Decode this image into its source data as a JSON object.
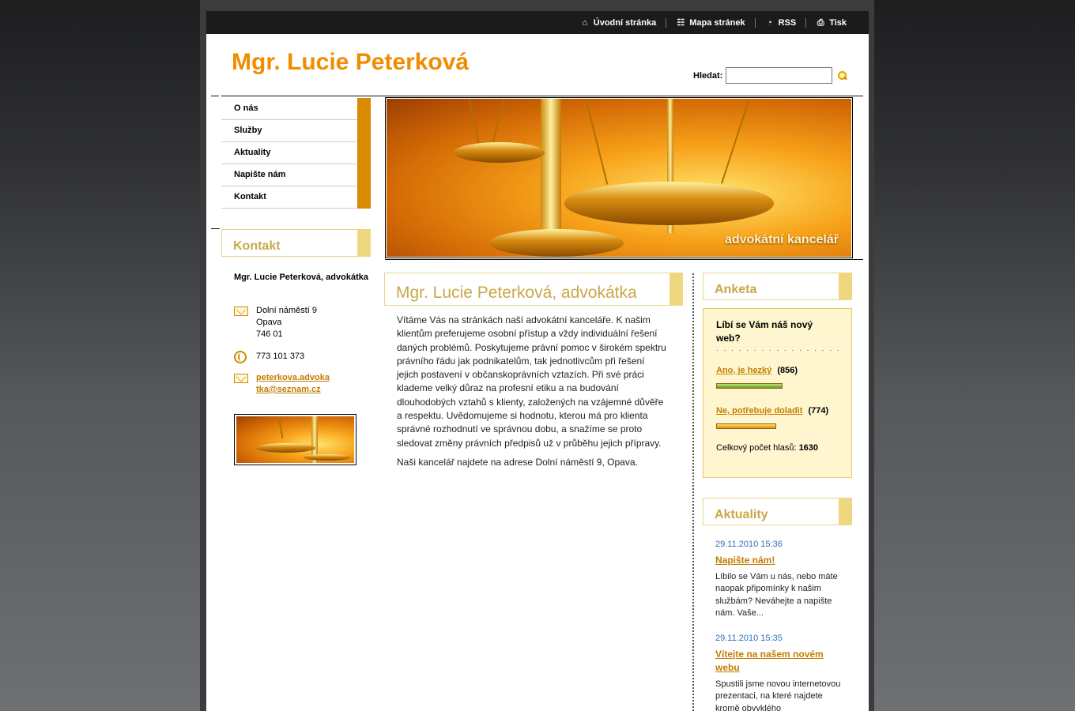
{
  "topnav": [
    {
      "label": "Úvodní stránka",
      "icon": "home-icon"
    },
    {
      "label": "Mapa stránek",
      "icon": "sitemap-icon"
    },
    {
      "label": "RSS",
      "icon": "rss-icon"
    },
    {
      "label": "Tisk",
      "icon": "print-icon"
    }
  ],
  "site": {
    "title": "Mgr. Lucie Peterková"
  },
  "search": {
    "label": "Hledat:",
    "value": ""
  },
  "nav": [
    "O nás",
    "Služby",
    "Aktuality",
    "Napište nám",
    "Kontakt"
  ],
  "contact": {
    "heading": "Kontakt",
    "name": "Mgr. Lucie Peterková, advokátka",
    "address": [
      "Dolní náměstí 9",
      "Opava",
      "746 01"
    ],
    "phone": "773 101 373",
    "email_line1": "peterkova.advoka",
    "email_line2": "tka@seznam.cz"
  },
  "banner": {
    "caption": "advokátní kancelář"
  },
  "article": {
    "title": "Mgr. Lucie Peterková, advokátka",
    "paragraphs": [
      "Vítáme Vás na stránkách naší advokátní kanceláře. K našim klientům preferujeme osobní přístup a vždy individuální řešení daných problémů. Poskytujeme právní pomoc v širokém spektru právního řádu jak podnikatelům, tak jednotlivcům při řešení jejich postavení v občanskoprávních vztazích. Při své práci klademe velký důraz na profesní etiku a na budování dlouhodobých vztahů s klienty, založených na vzájemné důvěře a respektu. Uvědomujeme si hodnotu, kterou má pro klienta správné rozhodnutí ve správnou dobu, a snažíme se proto sledovat změny právních předpisů už v průběhu jejich přípravy.",
      "Naši kancelář najdete na adrese Dolní náměstí 9, Opava."
    ]
  },
  "poll": {
    "heading": "Anketa",
    "question": "Líbí se Vám náš nový web?",
    "separator": ". . . . . . . . . . . . . . . . . .",
    "options": [
      {
        "label": "Ano, je hezký",
        "count": "(856)",
        "share": 0.525
      },
      {
        "label": "Ne, potřebuje doladit",
        "count": "(774)",
        "share": 0.475
      }
    ],
    "total_label": "Celkový počet hlasů:",
    "total": "1630"
  },
  "news": {
    "heading": "Aktuality",
    "items": [
      {
        "date": "29.11.2010 15:36",
        "title": "Napište nám!",
        "text": "Líbilo se Vám u nás, nebo máte naopak připomínky k našim službám? Neváhejte a napište nám. Vaše..."
      },
      {
        "date": "29.11.2010 15:35",
        "title": "Vítejte na našem novém webu",
        "text": "Spustili jsme novou internetovou prezentaci, na které najdete kromě obvyklého"
      }
    ]
  },
  "colors": {
    "accent": "#f08c00",
    "nav_tab": "#d98a00",
    "heading_gold": "#c9a84b",
    "link": "#c47d00",
    "date_blue": "#2f6fb5"
  }
}
